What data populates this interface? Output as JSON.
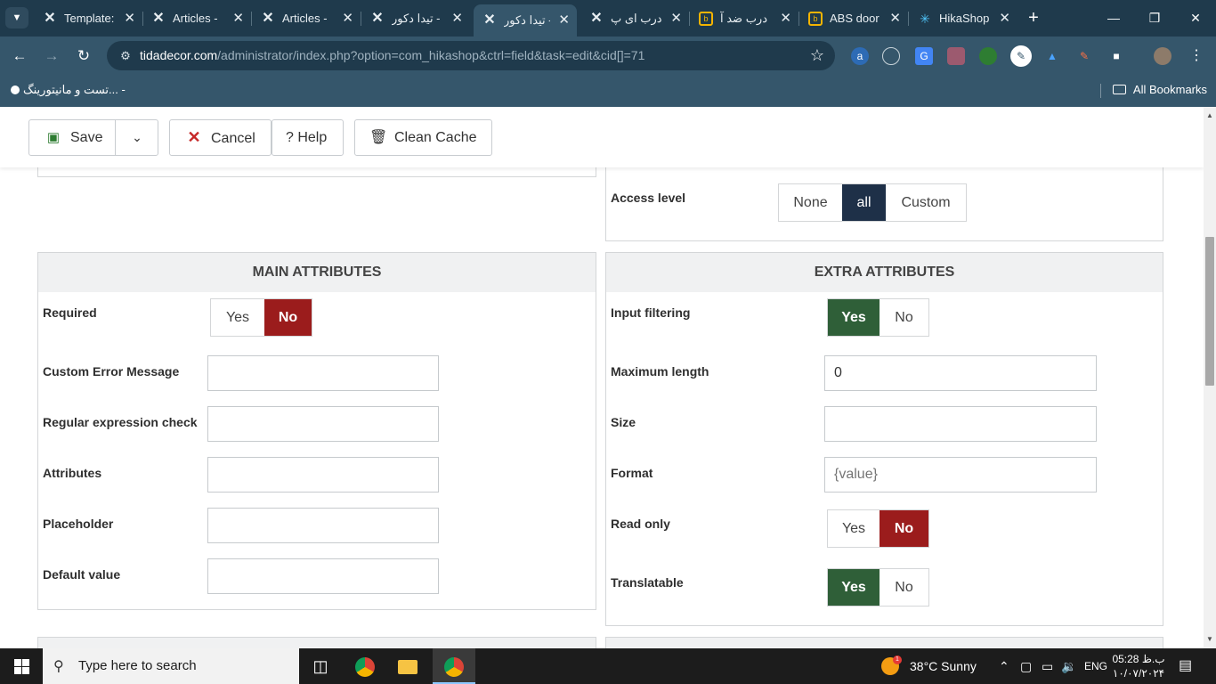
{
  "browser": {
    "tabs": [
      {
        "title": "Template:",
        "icon": "joomla-icon"
      },
      {
        "title": "Articles - ",
        "icon": "joomla-icon"
      },
      {
        "title": "Articles - ",
        "icon": "joomla-icon"
      },
      {
        "title": "تیدا دکور -",
        "icon": "joomla-icon"
      },
      {
        "title": "تیدا دکور -",
        "icon": "joomla-icon",
        "active": true
      },
      {
        "title": "درب ای پ",
        "icon": "joomla-icon"
      },
      {
        "title": "درب ضد آ",
        "icon": "site-box-icon"
      },
      {
        "title": "ABS door",
        "icon": "site-box-icon"
      },
      {
        "title": "HikaShop",
        "icon": "hikashop-icon"
      }
    ],
    "url_host": "tidadecor.com",
    "url_path": "/administrator/index.php?option=com_hikashop&ctrl=field&task=edit&cid[]=71",
    "bookmark_item": "تست و مانیتورینگ... -",
    "bookmarks_all": "All Bookmarks"
  },
  "toolbar": {
    "save_label": "Save",
    "cancel_label": "Cancel",
    "help_label": "? Help",
    "clean_cache_label": "Clean Cache"
  },
  "access": {
    "label": "Access level",
    "options": [
      "None",
      "all",
      "Custom"
    ],
    "selected": "all"
  },
  "main_attributes": {
    "title": "MAIN ATTRIBUTES",
    "required": {
      "label": "Required",
      "yes": "Yes",
      "no": "No",
      "value": "No"
    },
    "custom_error": {
      "label": "Custom Error Message",
      "value": ""
    },
    "regex": {
      "label": "Regular expression check",
      "value": ""
    },
    "attributes": {
      "label": "Attributes",
      "value": ""
    },
    "placeholder": {
      "label": "Placeholder",
      "value": ""
    },
    "default_value": {
      "label": "Default value",
      "value": ""
    }
  },
  "extra_attributes": {
    "title": "EXTRA ATTRIBUTES",
    "input_filtering": {
      "label": "Input filtering",
      "yes": "Yes",
      "no": "No",
      "value": "Yes"
    },
    "maximum_length": {
      "label": "Maximum length",
      "value": "0"
    },
    "size": {
      "label": "Size",
      "value": ""
    },
    "format": {
      "label": "Format",
      "placeholder": "{value}"
    },
    "read_only": {
      "label": "Read only",
      "yes": "Yes",
      "no": "No",
      "value": "No"
    },
    "translatable": {
      "label": "Translatable",
      "yes": "Yes",
      "no": "No",
      "value": "Yes"
    }
  },
  "taskbar": {
    "search_placeholder": "Type here to search",
    "weather": "38°C  Sunny",
    "weather_badge": "1",
    "lang": "ENG",
    "time": "05:28 ب.ظ",
    "date": "۱۰/۰۷/۲۰۲۴"
  },
  "colors": {
    "no_active": "#9b1c1c",
    "yes_active": "#2f5f38",
    "selected_navy": "#1e3048",
    "chrome_frame": "#1f3a4c",
    "chrome_toolbar": "#35566b"
  }
}
